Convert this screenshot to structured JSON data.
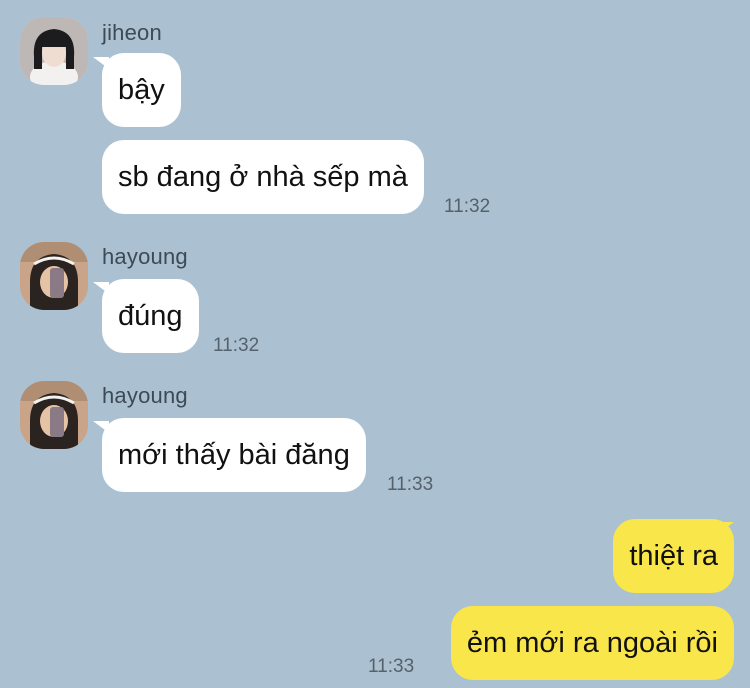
{
  "messages": [
    {
      "sender": "jiheon",
      "avatar": "avatar-jiheon",
      "lines": [
        "bậy",
        "sb đang ở nhà sếp mà"
      ],
      "time": "11:32"
    },
    {
      "sender": "hayoung",
      "avatar": "avatar-hayoung",
      "lines": [
        "đúng"
      ],
      "time": "11:32"
    },
    {
      "sender": "hayoung",
      "avatar": "avatar-hayoung",
      "lines": [
        "mới thấy bài đăng"
      ],
      "time": "11:33"
    },
    {
      "sender": "me",
      "lines": [
        "thiệt ra",
        "ẻm mới ra ngoài rồi"
      ],
      "time": "11:33"
    }
  ],
  "colors": {
    "background": "#abc1d1",
    "incoming_bubble": "#ffffff",
    "outgoing_bubble": "#f9e64b"
  }
}
